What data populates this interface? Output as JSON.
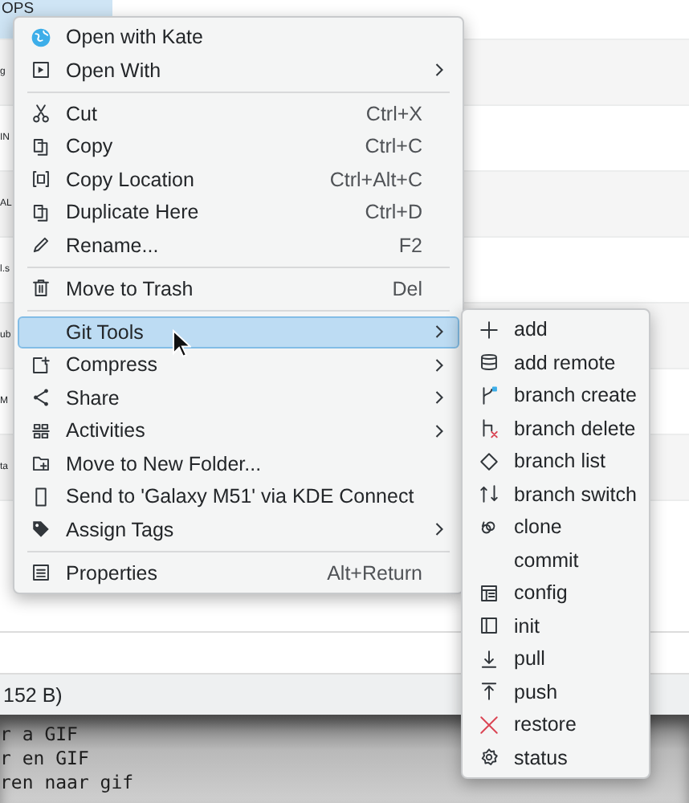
{
  "file_list": {
    "rows": [
      {
        "name": "OPS",
        "selected": true
      },
      {
        "name": "g",
        "selected": false
      },
      {
        "name": "IN",
        "selected": false
      },
      {
        "name": "AL",
        "selected": false
      },
      {
        "name": "l.s",
        "selected": false
      },
      {
        "name": "ub",
        "selected": false
      },
      {
        "name": "M",
        "selected": false
      },
      {
        "name": "ta",
        "selected": false
      }
    ]
  },
  "status_bar": {
    "text": "152 B)"
  },
  "terminal": {
    "lines": [
      "r a GIF",
      "r en GIF",
      "ren naar gif"
    ]
  },
  "context_menu": {
    "items": [
      {
        "kind": "item",
        "label": "Open with Kate",
        "submenu": false,
        "selected": false
      },
      {
        "kind": "item",
        "label": "Open With",
        "submenu": true,
        "selected": false
      },
      {
        "kind": "separator"
      },
      {
        "kind": "item",
        "label": "Cut",
        "shortcut": "Ctrl+X",
        "submenu": false,
        "selected": false
      },
      {
        "kind": "item",
        "label": "Copy",
        "shortcut": "Ctrl+C",
        "submenu": false,
        "selected": false
      },
      {
        "kind": "item",
        "label": "Copy Location",
        "shortcut": "Ctrl+Alt+C",
        "submenu": false,
        "selected": false
      },
      {
        "kind": "item",
        "label": "Duplicate Here",
        "shortcut": "Ctrl+D",
        "submenu": false,
        "selected": false
      },
      {
        "kind": "item",
        "label": "Rename...",
        "shortcut": "F2",
        "submenu": false,
        "selected": false
      },
      {
        "kind": "separator"
      },
      {
        "kind": "item",
        "label": "Move to Trash",
        "shortcut": "Del",
        "submenu": false,
        "selected": false
      },
      {
        "kind": "separator"
      },
      {
        "kind": "item",
        "label": "Git Tools",
        "submenu": true,
        "selected": true
      },
      {
        "kind": "item",
        "label": "Compress",
        "submenu": true,
        "selected": false
      },
      {
        "kind": "item",
        "label": "Share",
        "submenu": true,
        "selected": false
      },
      {
        "kind": "item",
        "label": "Activities",
        "submenu": true,
        "selected": false
      },
      {
        "kind": "item",
        "label": "Move to New Folder...",
        "submenu": false,
        "selected": false
      },
      {
        "kind": "item",
        "label": "Send to 'Galaxy M51' via KDE Connect",
        "submenu": false,
        "selected": false
      },
      {
        "kind": "item",
        "label": "Assign Tags",
        "submenu": true,
        "selected": false
      },
      {
        "kind": "separator"
      },
      {
        "kind": "item",
        "label": "Properties",
        "shortcut": "Alt+Return",
        "submenu": false,
        "selected": false
      }
    ]
  },
  "git_submenu": {
    "items": [
      {
        "label": "add"
      },
      {
        "label": "add remote"
      },
      {
        "label": "branch create"
      },
      {
        "label": "branch delete"
      },
      {
        "label": "branch list"
      },
      {
        "label": "branch switch"
      },
      {
        "label": "clone"
      },
      {
        "label": "commit"
      },
      {
        "label": "config"
      },
      {
        "label": "init"
      },
      {
        "label": "pull"
      },
      {
        "label": "push"
      },
      {
        "label": "restore"
      },
      {
        "label": "status"
      }
    ]
  }
}
